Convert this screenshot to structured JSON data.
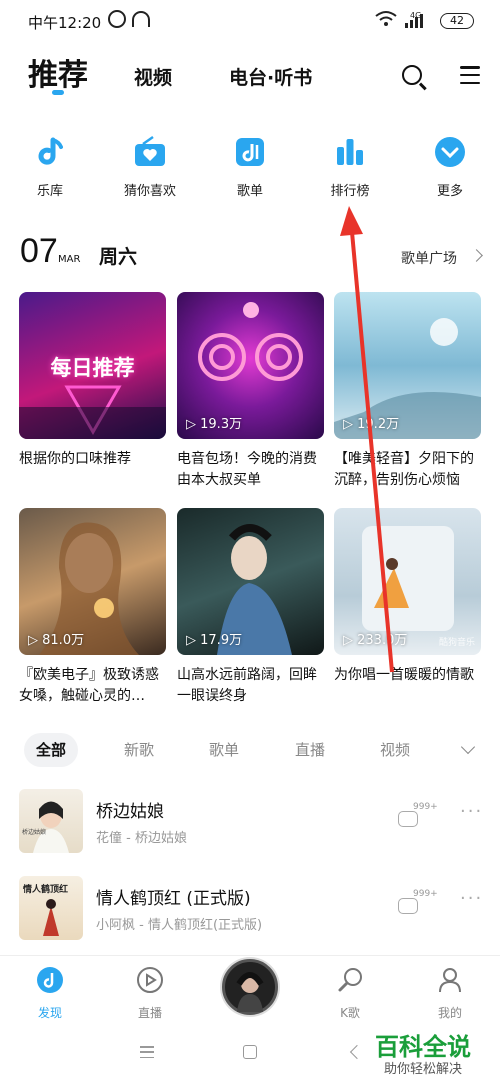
{
  "status": {
    "time": "中午12:20",
    "network": "4G",
    "battery": "42"
  },
  "topnav": {
    "tabs": [
      "推荐",
      "视频",
      "电台·听书"
    ],
    "active_index": 0
  },
  "quick": [
    {
      "label": "乐库",
      "icon": "music-note-icon"
    },
    {
      "label": "猜你喜欢",
      "icon": "radio-heart-icon"
    },
    {
      "label": "歌单",
      "icon": "playlist-icon"
    },
    {
      "label": "排行榜",
      "icon": "ranking-bars-icon"
    },
    {
      "label": "更多",
      "icon": "more-chevron-icon"
    }
  ],
  "date": {
    "day": "07",
    "month": "MAR",
    "weekday": "周六",
    "plaza": "歌单广场"
  },
  "cards": [
    {
      "title": "根据你的口味推荐",
      "cover_text": "每日推荐",
      "plays": ""
    },
    {
      "title": "电音包场！今晚的消费由本大叔买单",
      "plays": "19.3万"
    },
    {
      "title": "【唯美轻音】夕阳下的沉醉，告别伤心烦恼",
      "plays": "19.2万"
    },
    {
      "title": "『欧美电子』极致诱惑女嗓，触碰心灵的…",
      "plays": "81.0万"
    },
    {
      "title": "山高水远前路阔，回眸一眼误终身",
      "plays": "17.9万"
    },
    {
      "title": "为你唱一首暖暖的情歌",
      "plays": "233.0万",
      "badge": "酷狗音乐"
    }
  ],
  "filters": [
    "全部",
    "新歌",
    "歌单",
    "直播",
    "视频"
  ],
  "songs": [
    {
      "name": "桥边姑娘",
      "artist": "花僮 - 桥边姑娘",
      "comments": "999+",
      "thumb_text": "桥边姑娘"
    },
    {
      "name": "情人鹤顶红 (正式版)",
      "artist": "小阿枫 - 情人鹤顶红(正式版)",
      "comments": "999+",
      "thumb_text": "情人鹤顶红"
    }
  ],
  "bottomnav": [
    {
      "label": "发现",
      "active": true
    },
    {
      "label": "直播"
    },
    {
      "label": ""
    },
    {
      "label": "K歌"
    },
    {
      "label": "我的"
    }
  ],
  "watermark": {
    "title": "百科全说",
    "subtitle": "助你轻松解决"
  },
  "colors": {
    "accent": "#2aa6ef",
    "annotation_arrow": "#e8342a"
  }
}
